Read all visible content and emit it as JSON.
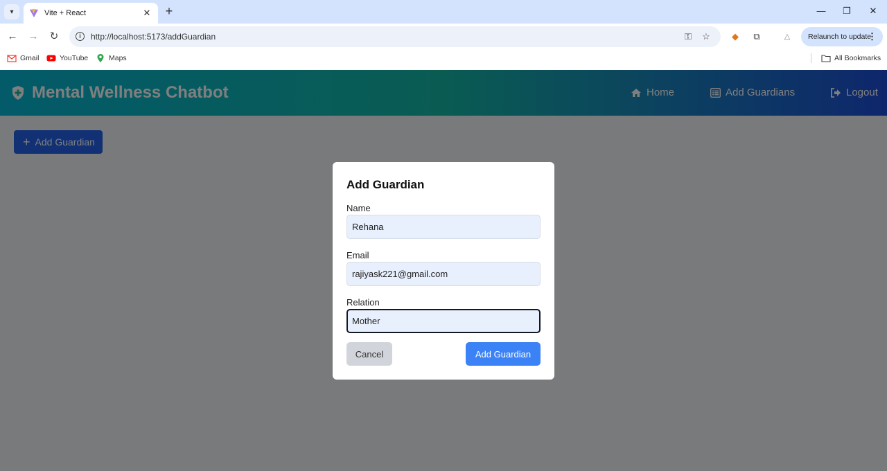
{
  "browser": {
    "tab_title": "Vite + React",
    "url": "http://localhost:5173/addGuardian",
    "relaunch_label": "Relaunch to update",
    "bookmarks": [
      {
        "label": "Gmail",
        "icon": "gmail-icon"
      },
      {
        "label": "YouTube",
        "icon": "youtube-icon"
      },
      {
        "label": "Maps",
        "icon": "maps-icon"
      }
    ],
    "all_bookmarks_label": "All Bookmarks"
  },
  "navbar": {
    "brand": "Mental Wellness Chatbot",
    "links": [
      {
        "label": "Home",
        "icon": "home-icon"
      },
      {
        "label": "Add Guardians",
        "icon": "list-icon"
      },
      {
        "label": "Logout",
        "icon": "logout-icon"
      }
    ],
    "colors": {
      "gradient_start": "#06b6d4",
      "gradient_mid": "#14b8a6",
      "gradient_end": "#1d4ed8"
    }
  },
  "page": {
    "add_button_label": "Add Guardian"
  },
  "modal": {
    "title": "Add Guardian",
    "fields": [
      {
        "label": "Name",
        "value": "Rehana"
      },
      {
        "label": "Email",
        "value": "rajiyask221@gmail.com"
      },
      {
        "label": "Relation",
        "value": "Mother"
      }
    ],
    "cancel_label": "Cancel",
    "submit_label": "Add Guardian",
    "colors": {
      "submit": "#3b82f6",
      "cancel": "#d1d5db"
    }
  }
}
